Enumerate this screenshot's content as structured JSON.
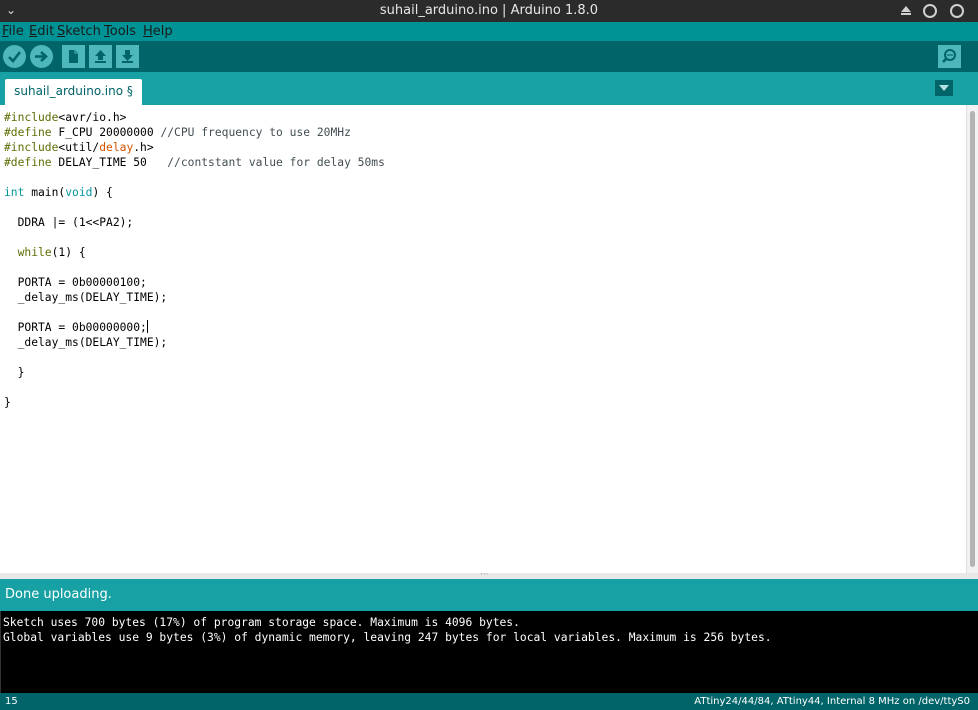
{
  "window": {
    "title": "suhail_arduino.ino | Arduino 1.8.0"
  },
  "menu": [
    {
      "key": "F",
      "rest": "ile"
    },
    {
      "key": "E",
      "rest": "dit"
    },
    {
      "key": "S",
      "rest": "ketch"
    },
    {
      "key": "T",
      "rest": "ools"
    },
    {
      "key": "H",
      "rest": "elp"
    }
  ],
  "toolbar": {
    "buttons": [
      "verify-icon",
      "upload-icon",
      "new-icon",
      "open-icon",
      "save-icon"
    ],
    "serial_monitor": "serial-monitor-icon"
  },
  "tab": {
    "label": "suhail_arduino.ino §"
  },
  "code": [
    [
      [
        "pre",
        "#include"
      ],
      [
        "txt",
        "<avr/io.h>"
      ]
    ],
    [
      [
        "pre",
        "#define"
      ],
      [
        "txt",
        " F_CPU 20000000 "
      ],
      [
        "cm",
        "//CPU frequency to use 20MHz"
      ]
    ],
    [
      [
        "pre",
        "#include"
      ],
      [
        "txt",
        "<util/"
      ],
      [
        "fn",
        "delay"
      ],
      [
        "txt",
        ".h>"
      ]
    ],
    [
      [
        "pre",
        "#define"
      ],
      [
        "txt",
        " DELAY_TIME 50   "
      ],
      [
        "cm",
        "//contstant value for delay 50ms"
      ]
    ],
    [],
    [
      [
        "type",
        "int"
      ],
      [
        "txt",
        " main("
      ],
      [
        "type",
        "void"
      ],
      [
        "txt",
        ") {"
      ]
    ],
    [],
    [
      [
        "txt",
        "  DDRA |= (1<<PA2);"
      ]
    ],
    [],
    [
      [
        "txt",
        "  "
      ],
      [
        "pre",
        "while"
      ],
      [
        "txt",
        "(1) {"
      ]
    ],
    [],
    [
      [
        "txt",
        "  PORTA = 0b00000100;"
      ]
    ],
    [
      [
        "txt",
        "  _delay_ms(DELAY_TIME);"
      ]
    ],
    [],
    [
      [
        "txt",
        "  PORTA = 0b00000000;"
      ],
      [
        "caret",
        ""
      ]
    ],
    [
      [
        "txt",
        "  _delay_ms(DELAY_TIME);"
      ]
    ],
    [],
    [
      [
        "txt",
        "  }"
      ]
    ],
    [],
    [
      [
        "txt",
        "}"
      ]
    ]
  ],
  "status": {
    "message": "Done uploading."
  },
  "console": [
    "Sketch uses 700 bytes (17%) of program storage space. Maximum is 4096 bytes.",
    "Global variables use 9 bytes (3%) of dynamic memory, leaving 247 bytes for local variables. Maximum is 256 bytes."
  ],
  "footer": {
    "line_number": "15",
    "board": "ATtiny24/44/84, ATtiny44, Internal 8 MHz on /dev/ttyS0"
  },
  "colors": {
    "menubar": "#009395",
    "toolbar": "#006468",
    "tabbar": "#17a1a5",
    "button": "#4db7bb"
  }
}
